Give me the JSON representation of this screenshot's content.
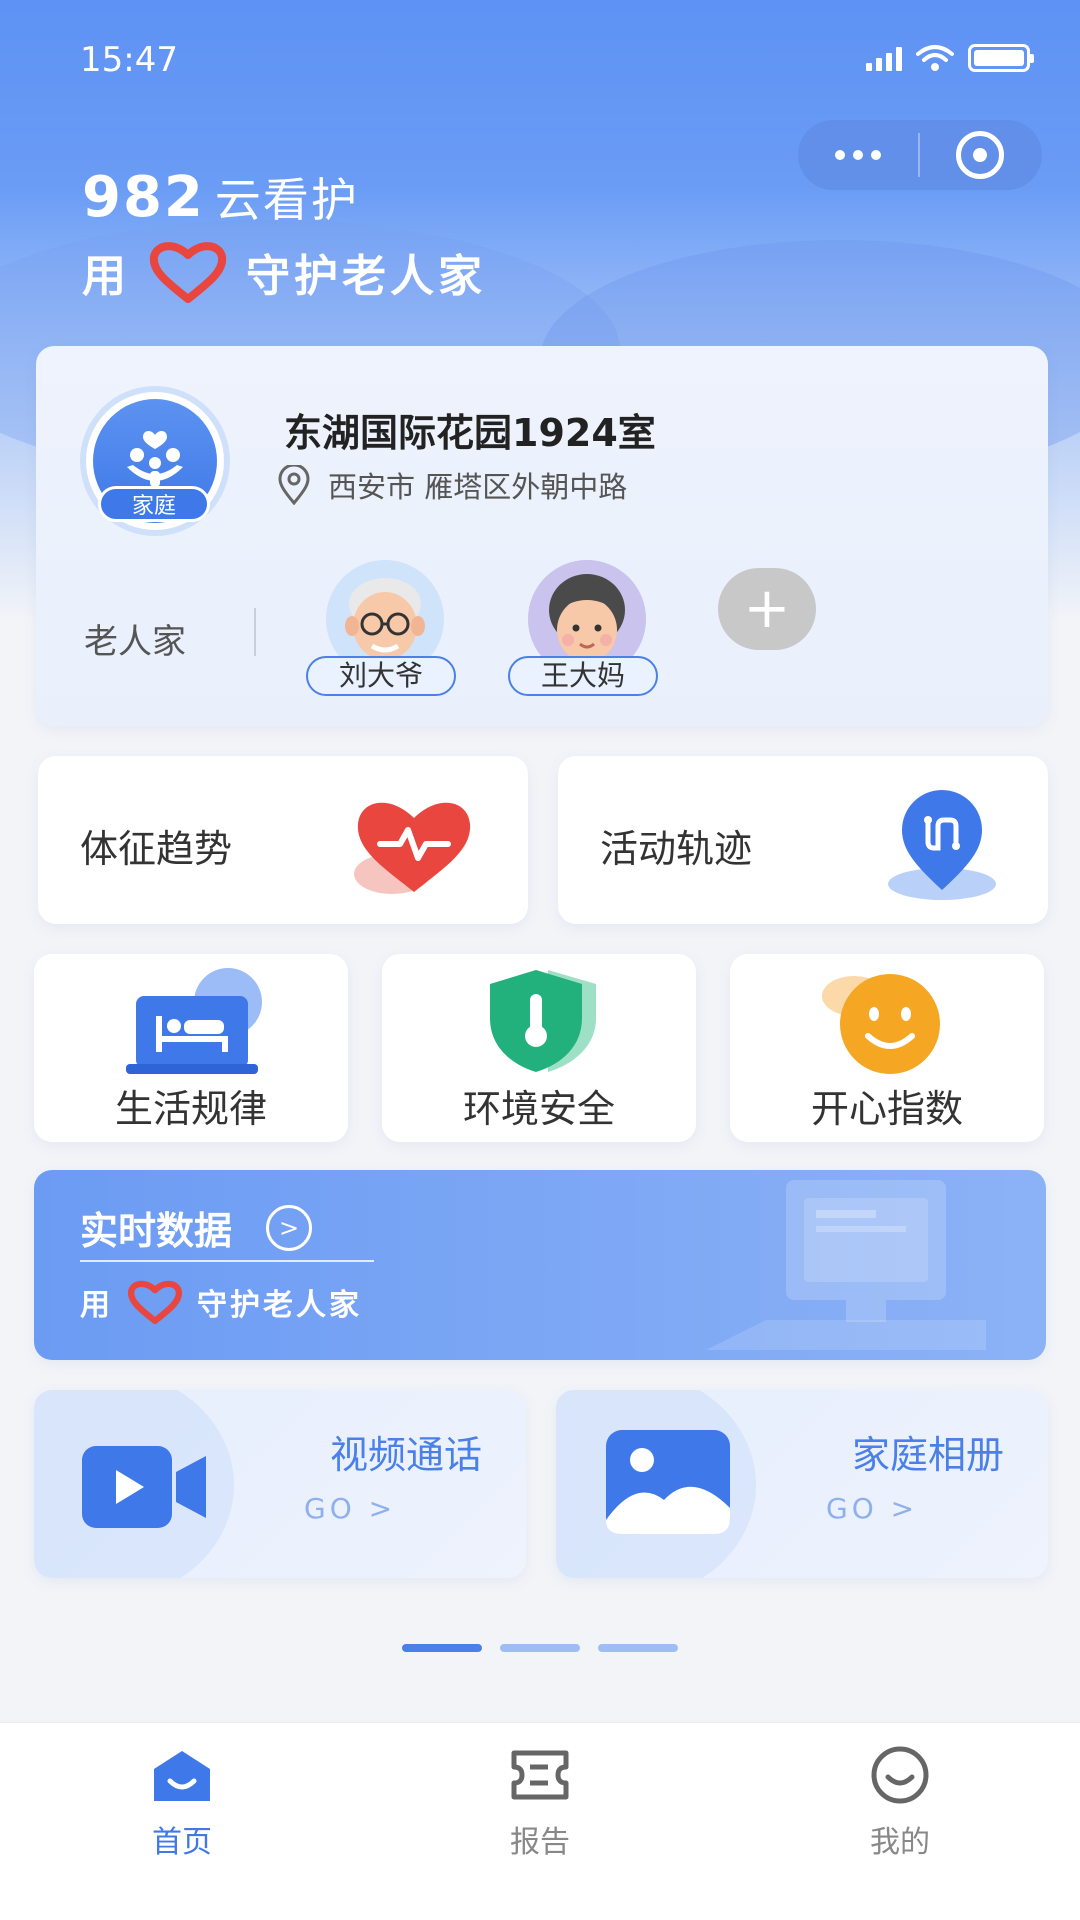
{
  "status_bar": {
    "time": "15:47"
  },
  "header": {
    "brand_number": "982",
    "brand_name": "云看护",
    "slogan_prefix": "用",
    "slogan_suffix": "守护老人家"
  },
  "family_card": {
    "tag": "家庭",
    "name": "东湖国际花园1924室",
    "address": "西安市 雁塔区外朝中路",
    "elders_label": "老人家",
    "elders": [
      {
        "name": "刘大爷"
      },
      {
        "name": "王大妈"
      }
    ],
    "add_label": "+"
  },
  "big_tiles": [
    {
      "label": "体征趋势",
      "icon": "heart-pulse-icon"
    },
    {
      "label": "活动轨迹",
      "icon": "location-track-icon"
    }
  ],
  "small_tiles": [
    {
      "label": "生活规律",
      "icon": "bed-icon"
    },
    {
      "label": "环境安全",
      "icon": "shield-thermometer-icon"
    },
    {
      "label": "开心指数",
      "icon": "smile-icon"
    }
  ],
  "banner": {
    "title": "实时数据",
    "arrow": ">",
    "slogan_prefix": "用",
    "slogan_suffix": "守护老人家"
  },
  "features": [
    {
      "title": "视频通话",
      "go": "GO  >",
      "icon": "video-camera-icon"
    },
    {
      "title": "家庭相册",
      "go": "GO  >",
      "icon": "photo-album-icon"
    }
  ],
  "carousel": {
    "count": 3,
    "active": 0
  },
  "tabbar": [
    {
      "label": "首页",
      "active": true
    },
    {
      "label": "报告",
      "active": false
    },
    {
      "label": "我的",
      "active": false
    }
  ],
  "colors": {
    "primary": "#3f78e8",
    "heart": "#e8463e",
    "shield": "#22b07d",
    "smile": "#f5a623"
  }
}
